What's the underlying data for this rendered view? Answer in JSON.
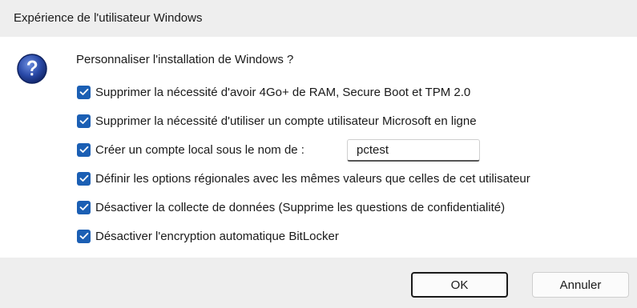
{
  "window": {
    "title": "Expérience de l'utilisateur Windows"
  },
  "dialog": {
    "icon": "question-icon",
    "question": "Personnaliser l'installation de Windows ?",
    "options": [
      {
        "label": "Supprimer la nécessité d'avoir 4Go+ de RAM, Secure Boot et TPM 2.0",
        "checked": true
      },
      {
        "label": "Supprimer la nécessité d'utiliser un compte utilisateur Microsoft en ligne",
        "checked": true
      },
      {
        "label": "Créer un compte local sous le nom de :",
        "checked": true
      },
      {
        "label": "Définir les options régionales avec les mêmes valeurs que celles de cet utilisateur",
        "checked": true
      },
      {
        "label": "Désactiver la collecte de données (Supprime les questions de confidentialité)",
        "checked": true
      },
      {
        "label": "Désactiver l'encryption automatique BitLocker",
        "checked": true
      }
    ],
    "local_account_name": "pctest"
  },
  "buttons": {
    "ok": "OK",
    "cancel": "Annuler"
  },
  "colors": {
    "checkbox": "#1b5fb4",
    "titlebar": "#eeeeee",
    "footer": "#eeeeee",
    "icon_blue": "#2a4aa8"
  }
}
